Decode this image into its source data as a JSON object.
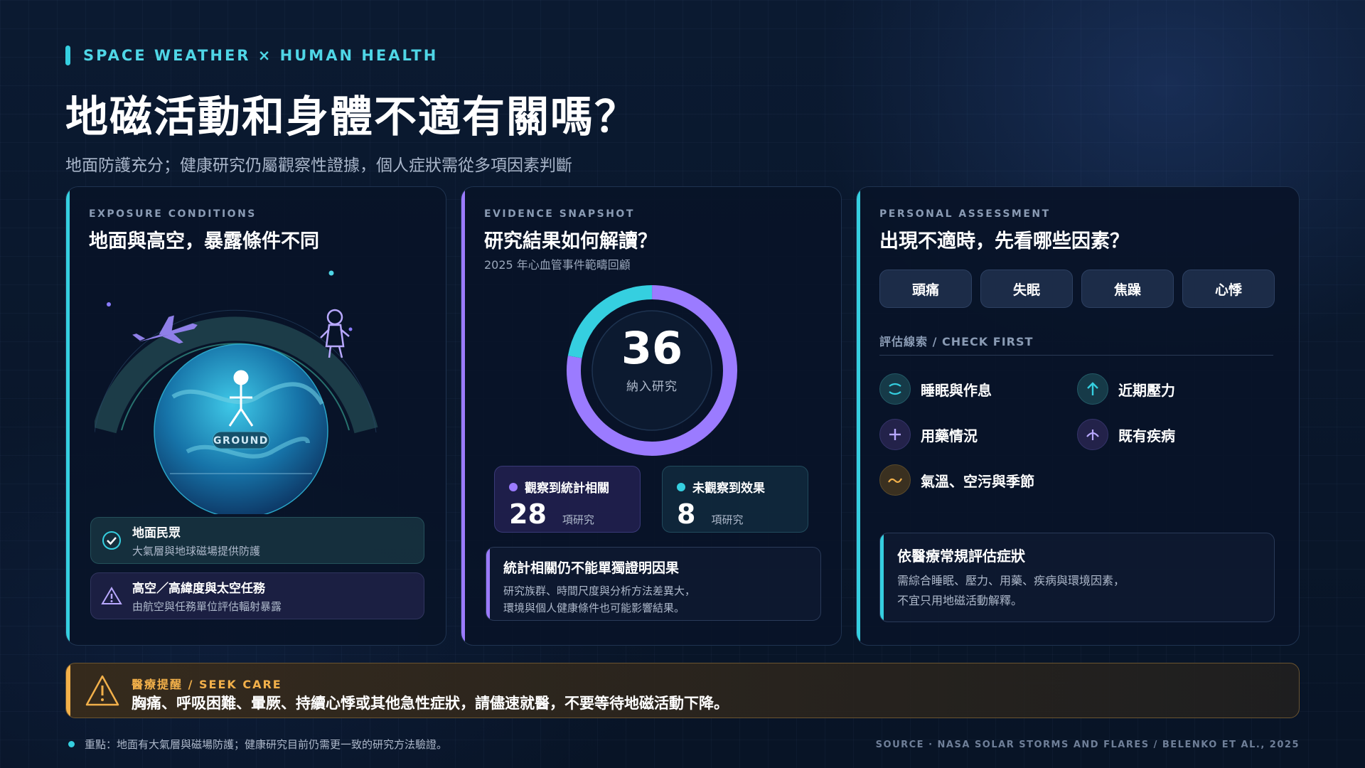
{
  "header": {
    "eyebrow": "SPACE WEATHER × HUMAN HEALTH",
    "title": "地磁活動和身體不適有關嗎？",
    "subtitle": "地面防護充分；健康研究仍屬觀察性證據，個人症狀需從多項因素判斷"
  },
  "exposure": {
    "label": "EXPOSURE CONDITIONS",
    "title": "地面與高空，暴露條件不同",
    "globe_label": "GROUND",
    "ground": {
      "title": "地面民眾",
      "desc": "大氣層與地球磁場提供防護"
    },
    "high": {
      "title": "高空／高緯度與太空任務",
      "desc": "由航空與任務單位評估輻射暴露"
    }
  },
  "evidence": {
    "label": "EVIDENCE SNAPSHOT",
    "title": "研究結果如何解讀？",
    "subtitle": "2025 年心血管事件範疇回顧",
    "total": "36",
    "total_label": "納入研究",
    "observed": {
      "label": "觀察到統計相關",
      "value": "28",
      "unit": "項研究"
    },
    "not_observed": {
      "label": "未觀察到效果",
      "value": "8",
      "unit": "項研究"
    },
    "note": {
      "title": "統計相關仍不能單獨證明因果",
      "line1": "研究族群、時間尺度與分析方法差異大，",
      "line2": "環境與個人健康條件也可能影響結果。"
    }
  },
  "chart_data": {
    "type": "pie",
    "categories": [
      "觀察到統計相關",
      "未觀察到效果"
    ],
    "values": [
      28,
      8
    ],
    "total": 36,
    "colors": [
      "#9b7bff",
      "#35cfe0"
    ]
  },
  "assessment": {
    "label": "PERSONAL ASSESSMENT",
    "title": "出現不適時，先看哪些因素？",
    "symptoms": [
      "頭痛",
      "失眠",
      "焦躁",
      "心悸"
    ],
    "check_label": "評估線索 / CHECK FIRST",
    "factors": {
      "sleep": "睡眠與作息",
      "stress": "近期壓力",
      "medication": "用藥情況",
      "disease": "既有疾病",
      "environment": "氣溫、空污與季節"
    },
    "advice": {
      "title": "依醫療常規評估症狀",
      "line1": "需綜合睡眠、壓力、用藥、疾病與環境因素，",
      "line2": "不宜只用地磁活動解釋。"
    }
  },
  "warning": {
    "label": "醫療提醒 / SEEK CARE",
    "text": "胸痛、呼吸困難、暈厥、持續心悸或其他急性症狀，請儘速就醫，不要等待地磁活動下降。"
  },
  "footer": {
    "note": "重點：地面有大氣層與磁場防護；健康研究目前仍需更一致的研究方法驗證。",
    "source": "SOURCE · NASA SOLAR STORMS AND FLARES / BELENKO ET AL., 2025"
  },
  "colors": {
    "cyan": "#35cfe0",
    "violet": "#9b7bff",
    "amber": "#f2b04a"
  },
  "icons": [
    "check-icon",
    "warning-icon",
    "sleep-icon",
    "stress-arrow-icon",
    "plus-icon",
    "disease-icon",
    "wave-icon",
    "airplane-icon",
    "astronaut-icon",
    "person-icon"
  ]
}
